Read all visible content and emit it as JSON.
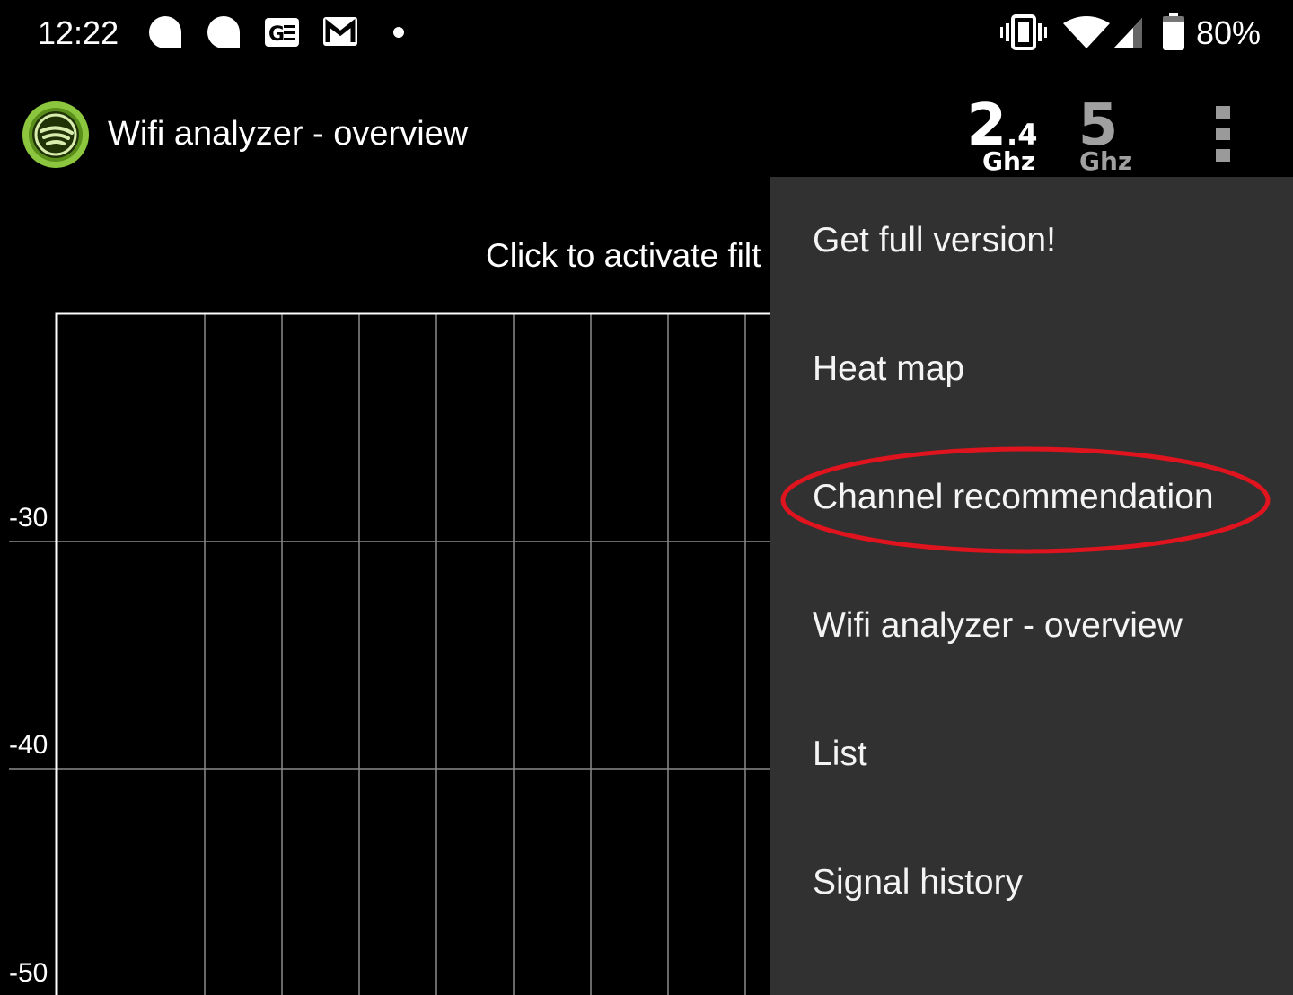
{
  "status_bar": {
    "time": "12:22",
    "notification_icons": [
      "chat-bubble-icon",
      "chat-bubble-icon",
      "news-icon",
      "gmail-icon",
      "dot-icon"
    ],
    "system_icons": [
      "vibrate-icon",
      "wifi-icon",
      "cell-signal-icon",
      "battery-icon"
    ],
    "battery_percent": "80%"
  },
  "app_bar": {
    "title": "Wifi analyzer - overview",
    "band_24": {
      "main": "2",
      "sub": ".4",
      "unit": "Ghz",
      "selected": true
    },
    "band_5": {
      "main": "5",
      "unit": "Ghz",
      "selected": false
    },
    "overflow_icon": "more-vert-icon"
  },
  "main": {
    "filter_hint": "Click to activate filt"
  },
  "chart_data": {
    "type": "line",
    "title": "",
    "xlabel": "",
    "ylabel": "",
    "y_ticks": [
      "-30",
      "-40",
      "-50"
    ],
    "grid": true,
    "series": []
  },
  "overflow_menu": {
    "items": [
      {
        "label": "Get full version!"
      },
      {
        "label": "Heat map"
      },
      {
        "label": "Channel recommendation",
        "highlighted": true
      },
      {
        "label": "Wifi analyzer - overview"
      },
      {
        "label": "List"
      },
      {
        "label": "Signal history"
      }
    ],
    "highlight_color": "#e0141e"
  },
  "colors": {
    "background": "#000000",
    "menu_background": "#313131",
    "logo_green": "#8cc63f",
    "grid_line": "#8a8a8a"
  }
}
